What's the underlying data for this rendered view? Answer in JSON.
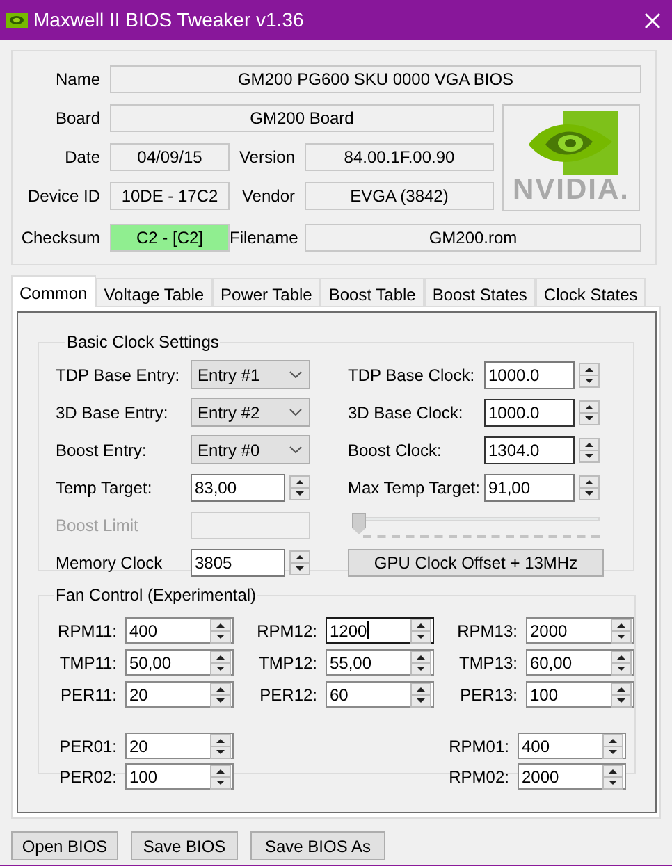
{
  "window": {
    "title": "Maxwell II BIOS Tweaker v1.36"
  },
  "info": {
    "name": {
      "label": "Name",
      "value": "GM200 PG600 SKU 0000 VGA BIOS"
    },
    "board": {
      "label": "Board",
      "value": "GM200 Board"
    },
    "date": {
      "label": "Date",
      "value": "04/09/15"
    },
    "version": {
      "label": "Version",
      "value": "84.00.1F.00.90"
    },
    "device_id": {
      "label": "Device ID",
      "value": "10DE - 17C2"
    },
    "vendor": {
      "label": "Vendor",
      "value": "EVGA (3842)"
    },
    "checksum": {
      "label": "Checksum",
      "value": "C2 - [C2]",
      "highlighted": true
    },
    "filename": {
      "label": "Filename",
      "value": "GM200.rom"
    },
    "logo_text": "NVIDIA."
  },
  "tabs": [
    {
      "label": "Common",
      "selected": true
    },
    {
      "label": "Voltage Table",
      "selected": false
    },
    {
      "label": "Power Table",
      "selected": false
    },
    {
      "label": "Boost Table",
      "selected": false
    },
    {
      "label": "Boost States",
      "selected": false
    },
    {
      "label": "Clock States",
      "selected": false
    }
  ],
  "basic_clock_settings": {
    "title": "Basic Clock Settings",
    "left": [
      {
        "kind": "combo",
        "label": "TDP Base Entry:",
        "value": "Entry #1",
        "disabled": false
      },
      {
        "kind": "combo",
        "label": "3D Base Entry:",
        "value": "Entry #2",
        "disabled": false
      },
      {
        "kind": "combo",
        "label": "Boost Entry:",
        "value": "Entry #0",
        "disabled": false
      },
      {
        "kind": "spin",
        "label": "Temp Target:",
        "value": "83,00",
        "disabled": false
      },
      {
        "kind": "text",
        "label": "Boost Limit",
        "disabled": true
      },
      {
        "kind": "spin",
        "label": "Memory Clock",
        "value": "3805",
        "disabled": false
      }
    ],
    "right": [
      {
        "kind": "spin",
        "label": "TDP Base Clock:",
        "value": "1000.0"
      },
      {
        "kind": "spin",
        "label": "3D Base Clock:",
        "value": "1000.0"
      },
      {
        "kind": "spin",
        "label": "Boost Clock:",
        "value": "1304.0"
      },
      {
        "kind": "spin",
        "label": "Max Temp Target:",
        "value": "91,00"
      },
      {
        "kind": "slider",
        "level": 0
      },
      {
        "kind": "button",
        "label": "GPU Clock Offset + 13MHz"
      }
    ]
  },
  "fan_control": {
    "title": "Fan Control (Experimental)",
    "grid": [
      [
        {
          "label": "RPM11:",
          "value": "400",
          "focused": false
        },
        {
          "label": "RPM12:",
          "value": "1200",
          "focused": true
        },
        {
          "label": "RPM13:",
          "value": "2000",
          "focused": false
        }
      ],
      [
        {
          "label": "TMP11:",
          "value": "50,00",
          "focused": false
        },
        {
          "label": "TMP12:",
          "value": "55,00",
          "focused": false
        },
        {
          "label": "TMP13:",
          "value": "60,00",
          "focused": false
        }
      ],
      [
        {
          "label": "PER11:",
          "value": "20",
          "focused": false
        },
        {
          "label": "PER12:",
          "value": "60",
          "focused": false
        },
        {
          "label": "PER13:",
          "value": "100",
          "focused": false
        }
      ]
    ],
    "extra": [
      {
        "left": {
          "label": "PER01:",
          "value": "20",
          "focused": false
        },
        "right": {
          "label": "RPM01:",
          "value": "400",
          "focused": false
        }
      },
      {
        "left": {
          "label": "PER02:",
          "value": "100",
          "focused": false
        },
        "right": {
          "label": "RPM02:",
          "value": "2000",
          "focused": false
        }
      }
    ]
  },
  "buttons": [
    "Open BIOS",
    "Save BIOS",
    "Save BIOS As"
  ]
}
